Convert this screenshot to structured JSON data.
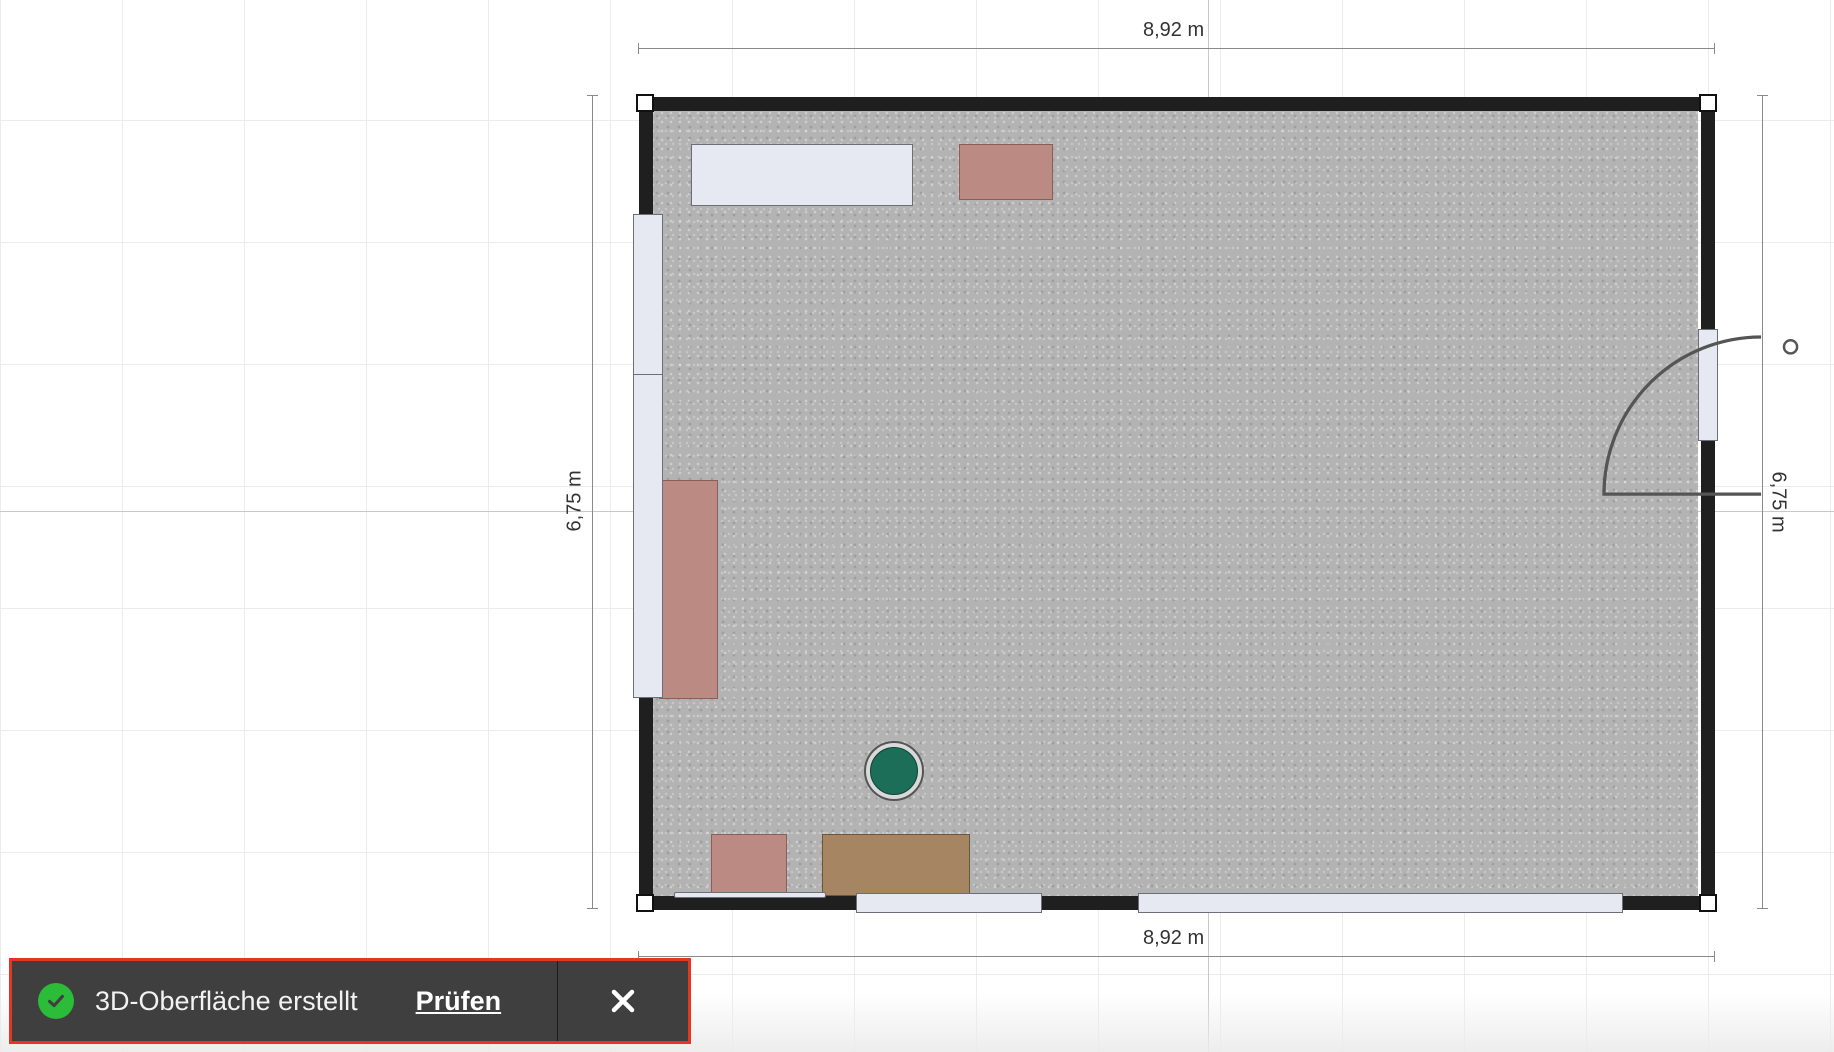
{
  "floorplan": {
    "dimensions": {
      "top": "8,92 m",
      "bottom": "8,92 m",
      "left": "6,75 m",
      "right": "6,75 m"
    }
  },
  "toast": {
    "message": "3D-Oberfläche erstellt",
    "action_label": "Prüfen",
    "close_icon": "close-icon",
    "check_icon": "check-circle-icon",
    "colors": {
      "background": "#3f3f3f",
      "highlight_border": "#e53525",
      "check": "#2bbc3a"
    }
  },
  "colors": {
    "wall": "#1f1f1f",
    "floor": "#b3b3b3",
    "plant": "#1c6e58",
    "cabinet": "#bb8b83",
    "table": "#a68562",
    "window": "#e6e8f2"
  }
}
